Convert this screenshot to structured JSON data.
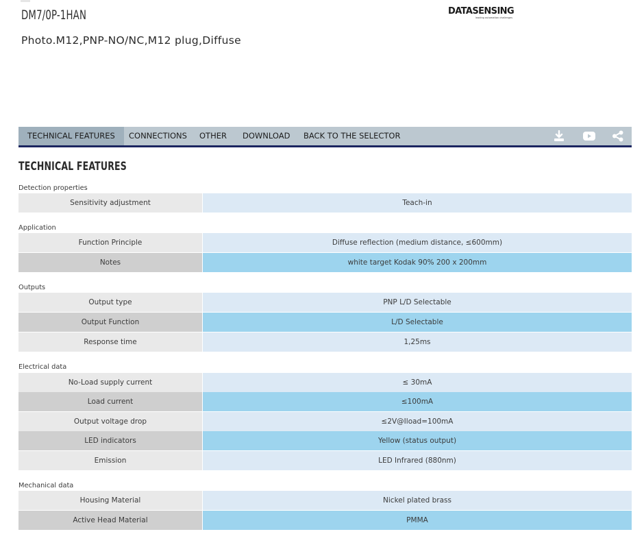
{
  "product": {
    "code": "DM7/0P-1HAN",
    "subtitle": "Photo.M12,PNP-NO/NC,M12 plug,Diffuse"
  },
  "logo": {
    "text": "DATASENSING",
    "tagline": "leading automation challenges"
  },
  "tabs": [
    {
      "label": "TECHNICAL FEATURES",
      "active": true
    },
    {
      "label": "CONNECTIONS"
    },
    {
      "label": "OTHER"
    },
    {
      "label": "DOWNLOAD"
    },
    {
      "label": "BACK TO THE SELECTOR"
    }
  ],
  "tab_icons": [
    "download-icon",
    "youtube-icon",
    "share-icon"
  ],
  "section_title": "TECHNICAL FEATURES",
  "groups": [
    {
      "title": "Detection properties",
      "rows": [
        {
          "k": "Sensitivity adjustment",
          "v": "Teach-in"
        }
      ]
    },
    {
      "title": "Application",
      "rows": [
        {
          "k": "Function Principle",
          "v": "Diffuse reflection (medium distance, ≤600mm)"
        },
        {
          "k": "Notes",
          "v": "white target Kodak 90% 200 x 200mm"
        }
      ]
    },
    {
      "title": "Outputs",
      "rows": [
        {
          "k": "Output type",
          "v": "PNP L/D Selectable"
        },
        {
          "k": "Output Function",
          "v": "L/D Selectable"
        },
        {
          "k": "Response time",
          "v": "1,25ms"
        }
      ]
    },
    {
      "title": "Electrical data",
      "rows": [
        {
          "k": "No-Load supply current",
          "v": "≤ 30mA"
        },
        {
          "k": "Load current",
          "v": "≤100mA"
        },
        {
          "k": "Output voltage drop",
          "v": "≤2V@Iload=100mA"
        },
        {
          "k": "LED indicators",
          "v": "Yellow (status output)"
        },
        {
          "k": "Emission",
          "v": "LED Infrared (880nm)"
        }
      ]
    },
    {
      "title": "Mechanical data",
      "rows": [
        {
          "k": "Housing Material",
          "v": "Nickel plated brass"
        },
        {
          "k": "Active Head Material",
          "v": "PMMA"
        }
      ]
    }
  ],
  "colors": {
    "tabbar_bg": "#bcc8d0",
    "tab_active_bg": "#9fb0bc",
    "tabbar_underline": "#1b2560",
    "key_cell": "#e9e9e9",
    "key_cell_alt": "#cfcfcf",
    "value_cell": "#dce9f5",
    "value_cell_alt": "#9dd4ee"
  }
}
